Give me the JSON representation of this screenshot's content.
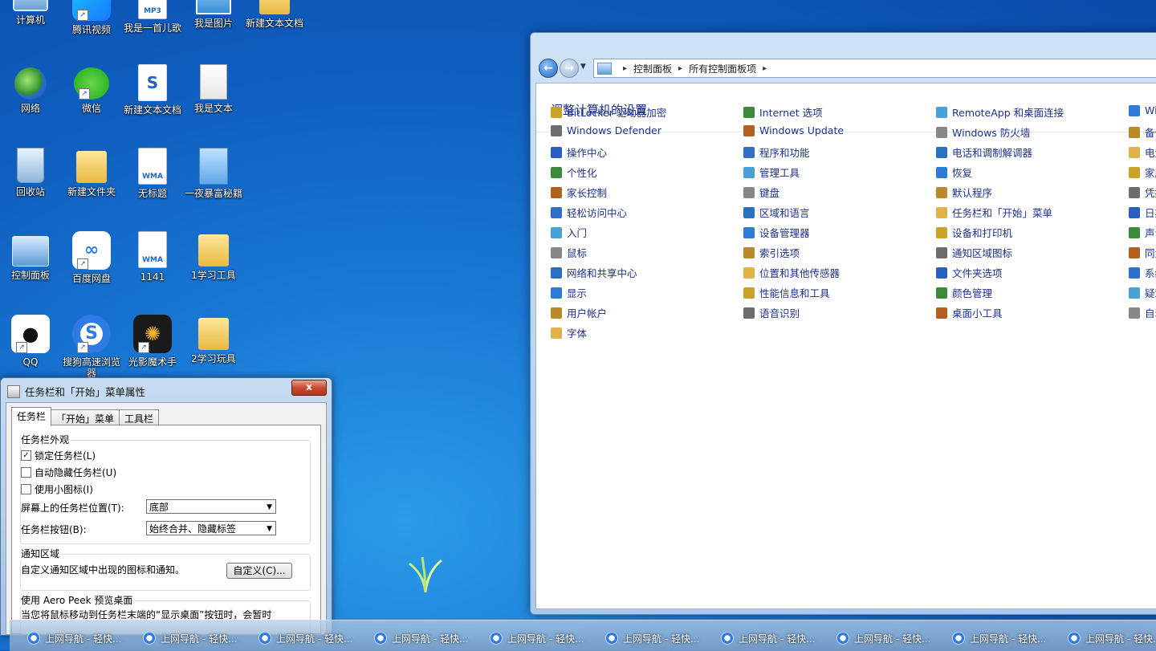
{
  "desktop": {
    "icons": [
      {
        "label": "计算机",
        "icon": "computer-icon"
      },
      {
        "label": "腾讯视频",
        "icon": "tencent-video-icon"
      },
      {
        "label": "我是一首儿歌",
        "icon": "mp3-file-icon",
        "badge": "MP3"
      },
      {
        "label": "我是图片",
        "icon": "image-file-icon"
      },
      {
        "label": "新建文本文档",
        "icon": "folder-icon"
      },
      {
        "label": "网络",
        "icon": "network-icon"
      },
      {
        "label": "微信",
        "icon": "wechat-icon"
      },
      {
        "label": "新建文本文档",
        "icon": "sogou-doc-icon"
      },
      {
        "label": "我是文本",
        "icon": "text-file-icon"
      },
      {
        "label": "回收站",
        "icon": "recycle-bin-icon"
      },
      {
        "label": "新建文件夹",
        "icon": "folder-icon"
      },
      {
        "label": "无标题",
        "icon": "wma-file-icon",
        "badge": "WMA"
      },
      {
        "label": "一夜暴富秘籍",
        "icon": "media-file-icon"
      },
      {
        "label": "控制面板",
        "icon": "control-panel-icon"
      },
      {
        "label": "百度网盘",
        "icon": "baidu-netdisk-icon"
      },
      {
        "label": "1141",
        "icon": "wma-file-icon",
        "badge": "WMA"
      },
      {
        "label": "1学习工具",
        "icon": "folder-icon"
      },
      {
        "label": "QQ",
        "icon": "qq-icon"
      },
      {
        "label": "搜狗高速浏览器",
        "icon": "sogou-browser-icon"
      },
      {
        "label": "光影魔术手",
        "icon": "guangying-icon"
      },
      {
        "label": "2学习玩具",
        "icon": "folder-icon"
      }
    ]
  },
  "control_panel": {
    "breadcrumb": [
      "控制面板",
      "所有控制面板项"
    ],
    "heading": "调整计算机的设置",
    "columns": [
      [
        "BitLocker 驱动器加密",
        "Windows Defender",
        "操作中心",
        "个性化",
        "家长控制",
        "轻松访问中心",
        "入门",
        "鼠标",
        "网络和共享中心",
        "显示",
        "用户帐户",
        "字体"
      ],
      [
        "Internet 选项",
        "Windows Update",
        "程序和功能",
        "管理工具",
        "键盘",
        "区域和语言",
        "设备管理器",
        "索引选项",
        "位置和其他传感器",
        "性能信息和工具",
        "语音识别"
      ],
      [
        "RemoteApp 和桌面连接",
        "Windows 防火墙",
        "电话和调制解调器",
        "恢复",
        "默认程序",
        "任务栏和「开始」菜单",
        "设备和打印机",
        "通知区域图标",
        "文件夹选项",
        "颜色管理",
        "桌面小工具"
      ],
      [
        "Wi",
        "备份",
        "电源",
        "家庭",
        "凭据",
        "日期",
        "声音",
        "同步",
        "系统",
        "疑难",
        "自动"
      ]
    ],
    "icon_colors": [
      "#c9a227",
      "#6d6d6d",
      "#2a5fbf",
      "#3a8a3a",
      "#b06020",
      "#2f6fc8",
      "#4aa0d8",
      "#888888",
      "#2a6fc0",
      "#2f7ad6",
      "#b88a2a",
      "#e2b24a"
    ]
  },
  "props_dialog": {
    "title": "任务栏和「开始」菜单属性",
    "close_label": "x",
    "tabs": [
      "任务栏",
      "「开始」菜单",
      "工具栏"
    ],
    "group_appearance": {
      "label": "任务栏外观",
      "lock": {
        "label": "锁定任务栏(L)",
        "checked": true
      },
      "autohide": {
        "label": "自动隐藏任务栏(U)",
        "checked": false
      },
      "small_icons": {
        "label": "使用小图标(I)",
        "checked": false
      },
      "position_label": "屏幕上的任务栏位置(T):",
      "position_value": "底部",
      "buttons_label": "任务栏按钮(B):",
      "buttons_value": "始终合并、隐藏标签"
    },
    "group_notify": {
      "label": "通知区域",
      "text": "自定义通知区域中出现的图标和通知。",
      "customize_button": "自定义(C)..."
    },
    "group_aero": {
      "label": "使用 Aero Peek 预览桌面",
      "text": "当您将鼠标移动到任务栏末端的“显示桌面”按钮时，会暂时"
    }
  },
  "taskbar": {
    "buttons": [
      "上网导航 - 轻快...",
      "上网导航 - 轻快...",
      "上网导航 - 轻快...",
      "上网导航 - 轻快...",
      "上网导航 - 轻快...",
      "上网导航 - 轻快...",
      "上网导航 - 轻快...",
      "上网导航 - 轻快...",
      "上网导航 - 轻快...",
      "上网导航 - 轻快..."
    ]
  }
}
